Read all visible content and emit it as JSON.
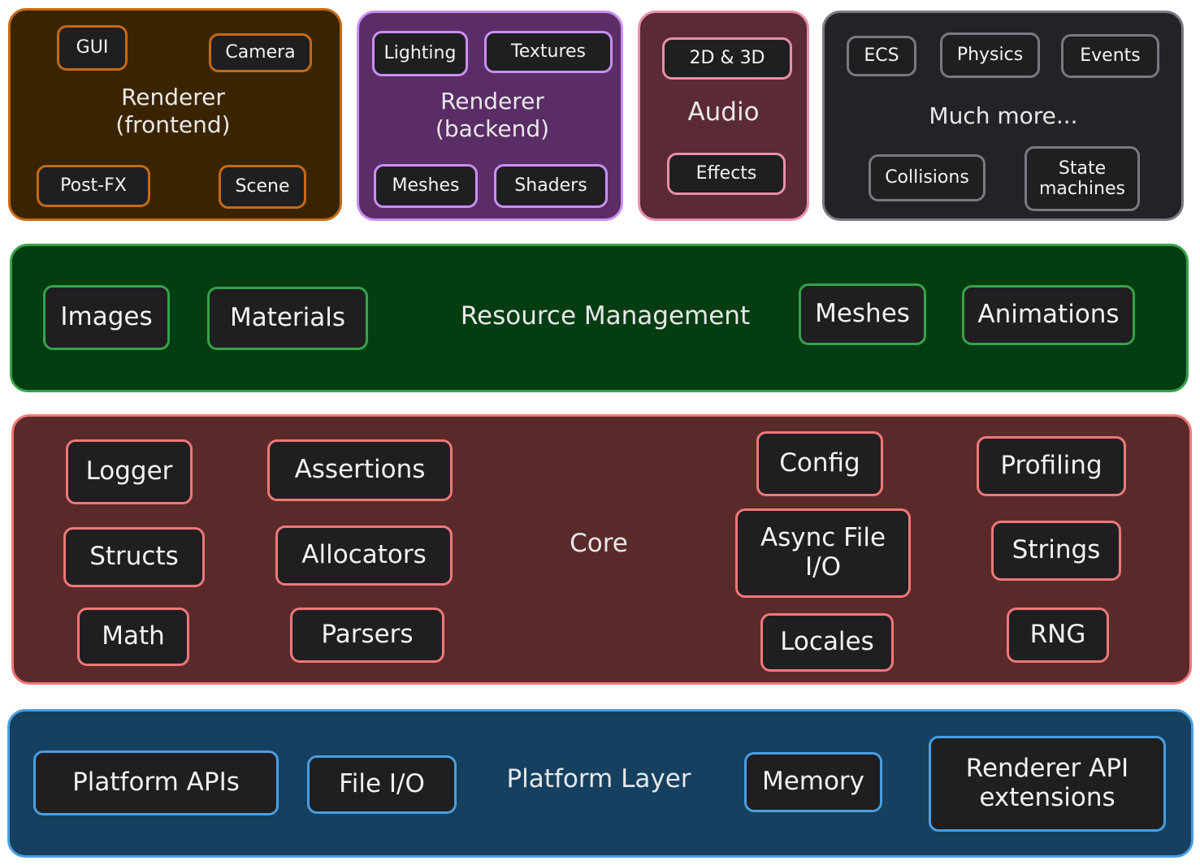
{
  "renderer_frontend": {
    "title": "Renderer\n(frontend)",
    "items": [
      "GUI",
      "Camera",
      "Post-FX",
      "Scene"
    ]
  },
  "renderer_backend": {
    "title": "Renderer\n(backend)",
    "items": [
      "Lighting",
      "Textures",
      "Meshes",
      "Shaders"
    ]
  },
  "audio": {
    "title": "Audio",
    "items": [
      "2D & 3D",
      "Effects"
    ]
  },
  "much_more": {
    "title": "Much more...",
    "items": [
      "ECS",
      "Physics",
      "Events",
      "Collisions",
      "State\nmachines"
    ]
  },
  "resource_management": {
    "title": "Resource Management",
    "items": [
      "Images",
      "Materials",
      "Meshes",
      "Animations"
    ]
  },
  "core": {
    "title": "Core",
    "items": [
      "Logger",
      "Assertions",
      "Config",
      "Profiling",
      "Structs",
      "Allocators",
      "Async File\nI/O",
      "Strings",
      "Math",
      "Parsers",
      "Locales",
      "RNG"
    ]
  },
  "platform_layer": {
    "title": "Platform Layer",
    "items": [
      "Platform APIs",
      "File I/O",
      "Memory",
      "Renderer API\nextensions"
    ]
  },
  "colors": {
    "renderer_frontend": "#c46a15",
    "renderer_backend": "#c98ff5",
    "audio": "#ea8fa8",
    "much_more": "#777a80",
    "resource_management": "#36a24a",
    "core": "#f07878",
    "platform_layer": "#4a9ee0"
  }
}
